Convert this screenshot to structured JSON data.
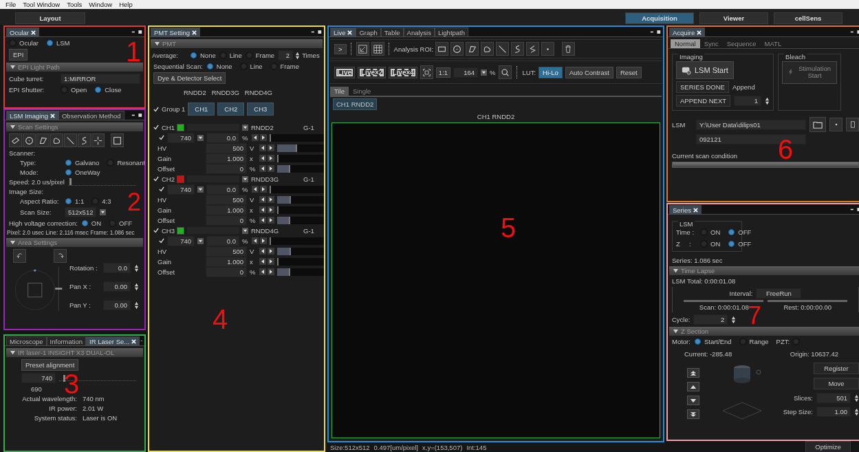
{
  "menu": [
    {
      "label": "File"
    },
    {
      "label": "Tool Window"
    },
    {
      "label": "Tools"
    },
    {
      "label": "Window"
    },
    {
      "label": "Help"
    }
  ],
  "layout_button": "Layout",
  "workspace_tabs": [
    {
      "label": "Acquisition",
      "selected": true
    },
    {
      "label": "Viewer",
      "selected": false
    },
    {
      "label": "cellSens",
      "selected": false
    }
  ],
  "ocular_panel": {
    "annotation": {
      "label": "1",
      "color": "#e53935"
    },
    "tabs": [
      {
        "label": "Ocular",
        "selected": true
      }
    ],
    "mode": [
      {
        "label": "Ocular",
        "selected": false
      },
      {
        "label": "LSM",
        "selected": true
      }
    ],
    "epi_button": "EPI",
    "section": "EPI Light Path",
    "cube_turret": {
      "label": "Cube turret:",
      "value": "1:MIRROR"
    },
    "shutter": {
      "label": "EPI Shutter:",
      "options": [
        {
          "label": "Open",
          "selected": false
        },
        {
          "label": "Close",
          "selected": true
        }
      ]
    }
  },
  "imaging_panel": {
    "annotation": {
      "label": "2",
      "color": "#a020c0"
    },
    "tabs": [
      {
        "label": "LSM Imaging",
        "selected": true
      },
      {
        "label": "Observation Method",
        "selected": false
      }
    ],
    "scan_section": "Scan Settings",
    "scanner_label": "Scanner:",
    "type": {
      "label": "Type:",
      "options": [
        {
          "label": "Galvano",
          "selected": true
        },
        {
          "label": "Resonant",
          "selected": false
        }
      ]
    },
    "mode": {
      "label": "Mode:",
      "options": [
        {
          "label": "OneWay",
          "selected": true
        }
      ]
    },
    "speed": {
      "label": "Speed:  2.0 us/pixel",
      "level": 0.02
    },
    "image_size_label": "Image Size:",
    "aspect": {
      "label": "Aspect Ratio:",
      "options": [
        {
          "label": "1:1",
          "selected": true
        },
        {
          "label": "4:3",
          "selected": false
        }
      ]
    },
    "scan_size": {
      "label": "Scan Size:",
      "value": "512x512"
    },
    "hv_correction": {
      "label": "High voltage correction:",
      "options": [
        {
          "label": "ON",
          "selected": true
        },
        {
          "label": "OFF",
          "selected": false
        }
      ]
    },
    "timing": "Pixel: 2.0 usec Line: 2.116 msec Frame: 1.086 sec",
    "area_section": "Area Settings",
    "area_fields": [
      {
        "label": "Rotation :",
        "value": "0.0"
      },
      {
        "label": "Pan  X :",
        "value": "0.00"
      },
      {
        "label": "Pan  Y :",
        "value": "0.00"
      }
    ]
  },
  "laser_panel": {
    "annotation": {
      "label": "3",
      "color": "#2db34a"
    },
    "tabs": [
      {
        "label": "Microscope",
        "selected": false
      },
      {
        "label": "Information",
        "selected": false
      },
      {
        "label": "IR Laser Se...",
        "selected": true
      }
    ],
    "section": "IR laser-1 INSIGHT X3 DUAL-OL",
    "preset_button": "Preset alignment",
    "wavelength": {
      "value": "740",
      "level": 0.05,
      "min_label": "690"
    },
    "info": [
      {
        "label": "Actual wavelength:",
        "value": "740 nm"
      },
      {
        "label": "IR power:",
        "value": "2.01 W"
      },
      {
        "label": "System status:",
        "value": "Laser is ON"
      }
    ]
  },
  "pmt_panel": {
    "annotation": {
      "label": "4",
      "color": "#f0e020"
    },
    "tabs": [
      {
        "label": "PMT Setting",
        "selected": true
      }
    ],
    "section": "PMT",
    "average": {
      "label": "Average:",
      "options": [
        {
          "label": "None",
          "selected": true
        },
        {
          "label": "Line",
          "selected": false
        },
        {
          "label": "Frame",
          "selected": false
        }
      ],
      "times_value": "2",
      "times_label": "Times"
    },
    "sequential": {
      "label": "Sequential Scan:",
      "options": [
        {
          "label": "None",
          "selected": true
        },
        {
          "label": "Line",
          "selected": false
        },
        {
          "label": "Frame",
          "selected": false
        }
      ]
    },
    "dye_button": "Dye & Detector Select",
    "detector_headers": [
      "RNDD2",
      "RNDD3G",
      "RNDD4G"
    ],
    "group": {
      "label": "Group 1",
      "checked": true,
      "buttons": [
        "CH1",
        "CH2",
        "CH3"
      ]
    },
    "channels": [
      {
        "name": "CH1",
        "checked": true,
        "color": "#22b022",
        "detector": "RNDD2",
        "range": "G-1",
        "laser_checked": true,
        "wavelength": "740",
        "power": "0.0",
        "power_unit": "%",
        "rows": [
          {
            "label": "HV",
            "value": "500",
            "unit": "V",
            "level": 0.4
          },
          {
            "label": "Gain",
            "value": "1.000",
            "unit": "x"
          },
          {
            "label": "Offset",
            "value": "0",
            "unit": "%",
            "level": 0.25
          }
        ]
      },
      {
        "name": "CH2",
        "checked": true,
        "color": "#c01818",
        "detector": "RNDD3G",
        "range": "G-1",
        "laser_checked": true,
        "wavelength": "740",
        "power": "0.0",
        "power_unit": "%",
        "rows": [
          {
            "label": "HV",
            "value": "500",
            "unit": "V",
            "level": 0.27
          },
          {
            "label": "Gain",
            "value": "1.000",
            "unit": "x"
          },
          {
            "label": "Offset",
            "value": "0",
            "unit": "%",
            "level": 0.25
          }
        ]
      },
      {
        "name": "CH3",
        "checked": true,
        "color": "#22b022",
        "detector": "RNDD4G",
        "range": "G-1",
        "laser_checked": true,
        "wavelength": "740",
        "power": "0.0",
        "power_unit": "%",
        "rows": [
          {
            "label": "HV",
            "value": "500",
            "unit": "V",
            "level": 0.27
          },
          {
            "label": "Gain",
            "value": "1.000",
            "unit": "x"
          },
          {
            "label": "Offset",
            "value": "0",
            "unit": "%",
            "level": 0.25
          }
        ]
      }
    ]
  },
  "live_panel": {
    "annotation": {
      "label": "5",
      "color": "#1e90e0"
    },
    "tabs": [
      {
        "label": "Live",
        "selected": true
      },
      {
        "label": "Graph",
        "selected": false
      },
      {
        "label": "Table",
        "selected": false
      },
      {
        "label": "Analysis",
        "selected": false
      },
      {
        "label": "Lightpath",
        "selected": false
      }
    ],
    "play_button": ">",
    "roi_label": "Analysis ROI:",
    "scan_buttons": [
      "Live",
      "Live×2",
      "Live×4"
    ],
    "one_to_one": "1:1",
    "zoom_value": "164",
    "zoom_unit": "%",
    "lut_label": "LUT:",
    "lut_buttons": [
      {
        "label": "Hi-Lo",
        "selected": true
      },
      {
        "label": "Auto Contrast",
        "selected": false
      },
      {
        "label": "Reset",
        "selected": false
      }
    ],
    "view_tabs": [
      {
        "label": "Tile",
        "selected": true
      },
      {
        "label": "Single",
        "selected": false
      }
    ],
    "channel_chip": "CH1 RNDD2",
    "image_title": "CH1 RNDD2"
  },
  "status_bar": [
    "Size:512x512",
    "0.497[um/pixel]",
    "x,y=(153,507)",
    "Int:145"
  ],
  "acquire_panel": {
    "annotation": {
      "label": "6",
      "color": "#e07820"
    },
    "tabs": [
      {
        "label": "Acquire",
        "selected": true
      }
    ],
    "subtabs": [
      {
        "label": "Normal",
        "selected": true
      },
      {
        "label": "Sync",
        "selected": false
      },
      {
        "label": "Sequence",
        "selected": false
      },
      {
        "label": "MATL",
        "selected": false
      }
    ],
    "imaging_group": "Imaging",
    "start_button": "LSM Start",
    "series_done": "SERIES DONE",
    "append_label": "Append",
    "append_next": "APPEND NEXT",
    "append_value": "1",
    "bleach_group": "Bleach",
    "stim_button": {
      "label": "Stimulation Start",
      "disabled": true
    },
    "lsm_label": "LSM",
    "path": "Y:\\User Data\\dilips01",
    "file_name": "092121",
    "scan_condition": "Current scan condition"
  },
  "series_panel": {
    "annotation": {
      "label": "7",
      "color": "#f4a0a8"
    },
    "tabs": [
      {
        "label": "Series",
        "selected": true
      }
    ],
    "lsm_group": "LSM",
    "switches": [
      {
        "label": "Time :",
        "options": [
          {
            "label": "ON",
            "selected": false
          },
          {
            "label": "OFF",
            "selected": true
          }
        ]
      },
      {
        "label": "Z     :",
        "options": [
          {
            "label": "ON",
            "selected": false
          },
          {
            "label": "OFF",
            "selected": true
          }
        ]
      }
    ],
    "series_time": "Series: 1.086 sec",
    "time_section": "Time Lapse",
    "lsm_total": "LSM Total:  0:00:01.08",
    "interval_label": "Interval:",
    "interval_value": "FreeRun",
    "scan_time": "Scan:  0:00:01.08",
    "rest_time": "Rest:  0:00:00.00",
    "cycle": {
      "label": "Cycle:",
      "value": "2"
    },
    "z_section": "Z Section",
    "motor": {
      "label": "Motor:",
      "options": [
        {
          "label": "Start/End",
          "selected": true
        },
        {
          "label": "Range",
          "selected": false
        }
      ]
    },
    "pzt": {
      "label": "PZT:",
      "selected": false
    },
    "current": "Current: -285.48",
    "origin": "Origin: 10637.42",
    "register_button": "Register",
    "move_button": "Move",
    "slices": {
      "label": "Slices:",
      "value": "501"
    },
    "step": {
      "label": "Step Size:",
      "value": "1.00"
    },
    "optimize_button": "Optimize"
  }
}
